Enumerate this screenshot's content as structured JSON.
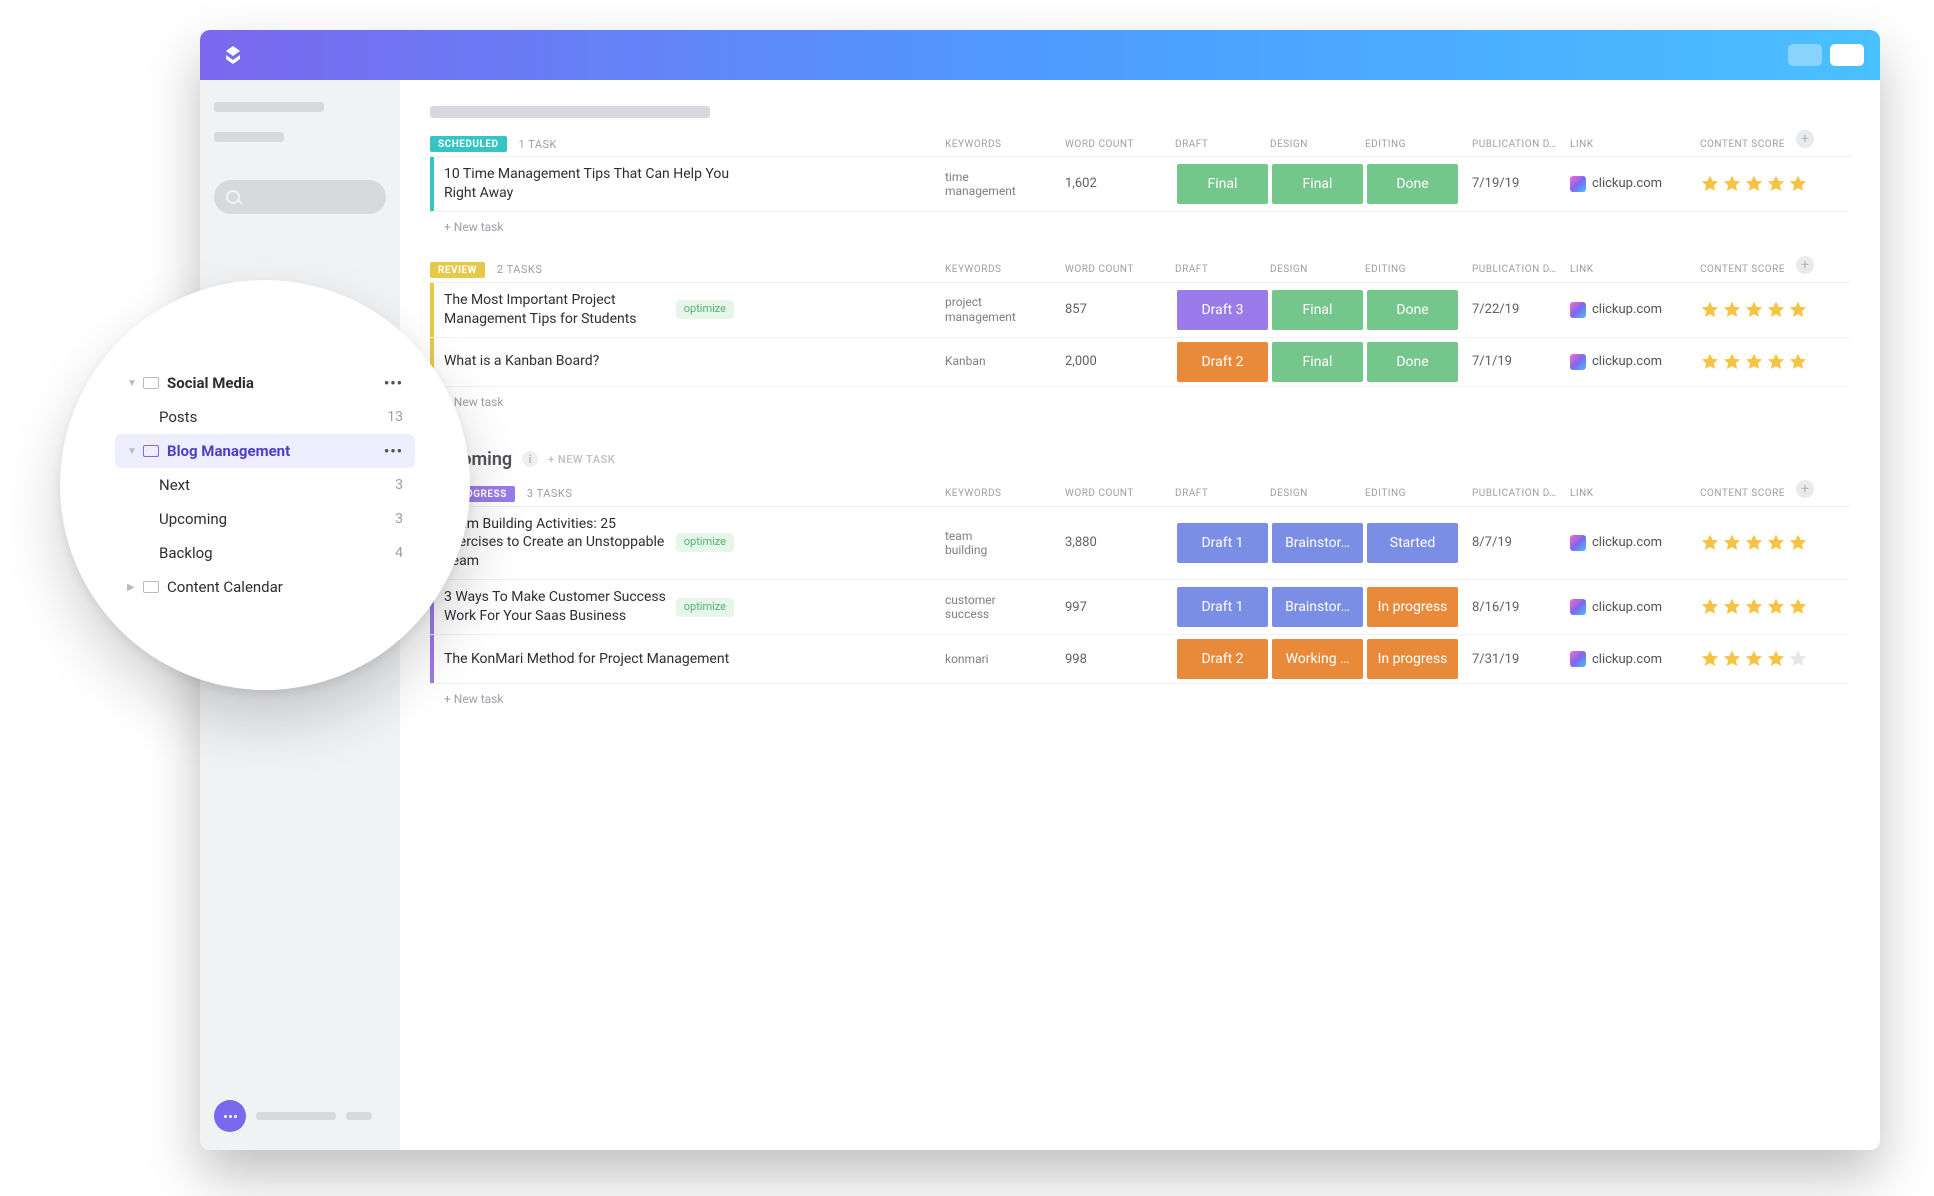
{
  "colors": {
    "scheduled": "#36c4c4",
    "review": "#e6c84a",
    "inprogress": "#9b7aea"
  },
  "columns": {
    "keywords": "KEYWORDS",
    "word_count": "WORD COUNT",
    "draft": "DRAFT",
    "design": "DESIGN",
    "editing": "EDITING",
    "publication_date": "PUBLICATION D…",
    "link": "LINK",
    "content_score": "CONTENT SCORE"
  },
  "new_task_label": "+ New task",
  "section": {
    "upcoming_title": "Upcoming",
    "new_task": "+ NEW TASK"
  },
  "groups": [
    {
      "status": "SCHEDULED",
      "status_color": "#36c4c4",
      "left_bar": "#36c4c4",
      "task_count_label": "1 TASK",
      "rows": [
        {
          "title": "10 Time Management Tips That Can Help You Right Away",
          "optimize": false,
          "keywords": "time management",
          "word_count": "1,602",
          "draft": {
            "text": "Final",
            "style": "green"
          },
          "design": {
            "text": "Final",
            "style": "green"
          },
          "editing": {
            "text": "Done",
            "style": "green"
          },
          "date": "7/19/19",
          "link": "clickup.com",
          "stars": 5
        }
      ]
    },
    {
      "status": "REVIEW",
      "status_color": "#e6c84a",
      "left_bar": "#e6c84a",
      "task_count_label": "2 TASKS",
      "rows": [
        {
          "title": "The Most Important Project Management Tips for Students",
          "optimize": true,
          "keywords": "project management",
          "word_count": "857",
          "draft": {
            "text": "Draft 3",
            "style": "purple"
          },
          "design": {
            "text": "Final",
            "style": "green"
          },
          "editing": {
            "text": "Done",
            "style": "green"
          },
          "date": "7/22/19",
          "link": "clickup.com",
          "stars": 5
        },
        {
          "title": "What is a Kanban Board?",
          "optimize": false,
          "keywords": "Kanban",
          "word_count": "2,000",
          "draft": {
            "text": "Draft 2",
            "style": "orange"
          },
          "design": {
            "text": "Final",
            "style": "green"
          },
          "editing": {
            "text": "Done",
            "style": "green"
          },
          "date": "7/1/19",
          "link": "clickup.com",
          "stars": 5
        }
      ]
    },
    {
      "status": "IN PROGRESS",
      "status_color": "#9b7aea",
      "left_bar": "#9b7aea",
      "task_count_label": "3 TASKS",
      "rows": [
        {
          "title": "Team Building Activities: 25 Exercises to Create an Unstoppable Team",
          "optimize": true,
          "keywords": "team building",
          "word_count": "3,880",
          "draft": {
            "text": "Draft 1",
            "style": "blue"
          },
          "design": {
            "text": "Brainstor…",
            "style": "blue"
          },
          "editing": {
            "text": "Started",
            "style": "blue"
          },
          "date": "8/7/19",
          "link": "clickup.com",
          "stars": 5
        },
        {
          "title": "3 Ways To Make Customer Success Work For Your Saas Business",
          "optimize": true,
          "keywords": "customer success",
          "word_count": "997",
          "draft": {
            "text": "Draft 1",
            "style": "blue"
          },
          "design": {
            "text": "Brainstor…",
            "style": "blue"
          },
          "editing": {
            "text": "In progress",
            "style": "orange"
          },
          "date": "8/16/19",
          "link": "clickup.com",
          "stars": 5
        },
        {
          "title": "The KonMari Method for Project Management",
          "optimize": false,
          "keywords": "konmari",
          "word_count": "998",
          "draft": {
            "text": "Draft 2",
            "style": "orange"
          },
          "design": {
            "text": "Working …",
            "style": "orange"
          },
          "editing": {
            "text": "In progress",
            "style": "orange"
          },
          "date": "7/31/19",
          "link": "clickup.com",
          "stars": 4
        }
      ]
    }
  ],
  "popover": {
    "items": [
      {
        "type": "folder",
        "label": "Social Media",
        "expanded": true,
        "dots": true
      },
      {
        "type": "child",
        "label": "Posts",
        "count": "13"
      },
      {
        "type": "folder",
        "label": "Blog Management",
        "expanded": true,
        "selected": true,
        "dots": true
      },
      {
        "type": "child",
        "label": "Next",
        "count": "3"
      },
      {
        "type": "child",
        "label": "Upcoming",
        "count": "3"
      },
      {
        "type": "child",
        "label": "Backlog",
        "count": "4"
      },
      {
        "type": "folder",
        "label": "Content Calendar",
        "expanded": false
      }
    ]
  },
  "optimize_tag": "optimize"
}
